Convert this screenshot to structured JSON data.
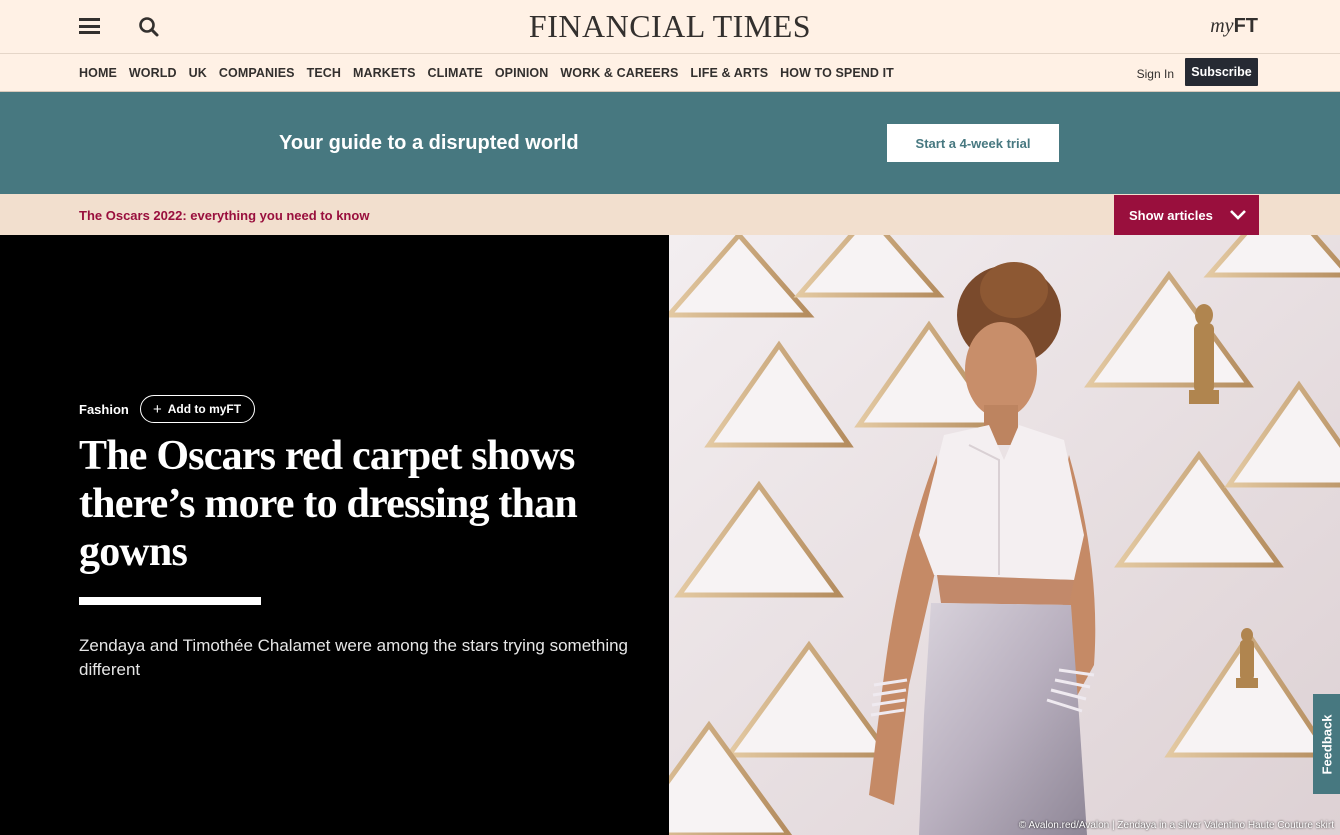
{
  "header": {
    "logo": "FINANCIAL TIMES",
    "myft_prefix": "my",
    "myft_suffix": "FT"
  },
  "nav": {
    "items": [
      "HOME",
      "WORLD",
      "UK",
      "COMPANIES",
      "TECH",
      "MARKETS",
      "CLIMATE",
      "OPINION",
      "WORK & CAREERS",
      "LIFE & ARTS",
      "HOW TO SPEND IT"
    ],
    "signin": "Sign In",
    "subscribe": "Subscribe"
  },
  "promo": {
    "text": "Your guide to a disrupted world",
    "button": "Start a 4-week trial"
  },
  "series": {
    "title": "The Oscars 2022: everything you need to know",
    "show_articles": "Show articles"
  },
  "article": {
    "topic": "Fashion",
    "add_to_myft": "Add to myFT",
    "headline": "The Oscars red carpet shows there’s more to dressing than gowns",
    "standfirst": "Zendaya and Timothée Chalamet were among the stars trying something different",
    "caption": "© Avalon.red/Avalon | Zendaya in a silver Valentino Haute Couture skirt"
  },
  "feedback": "Feedback",
  "colors": {
    "paper": "#fff1e5",
    "teal": "#477880",
    "claret": "#990f3d",
    "slate": "#262a33"
  }
}
